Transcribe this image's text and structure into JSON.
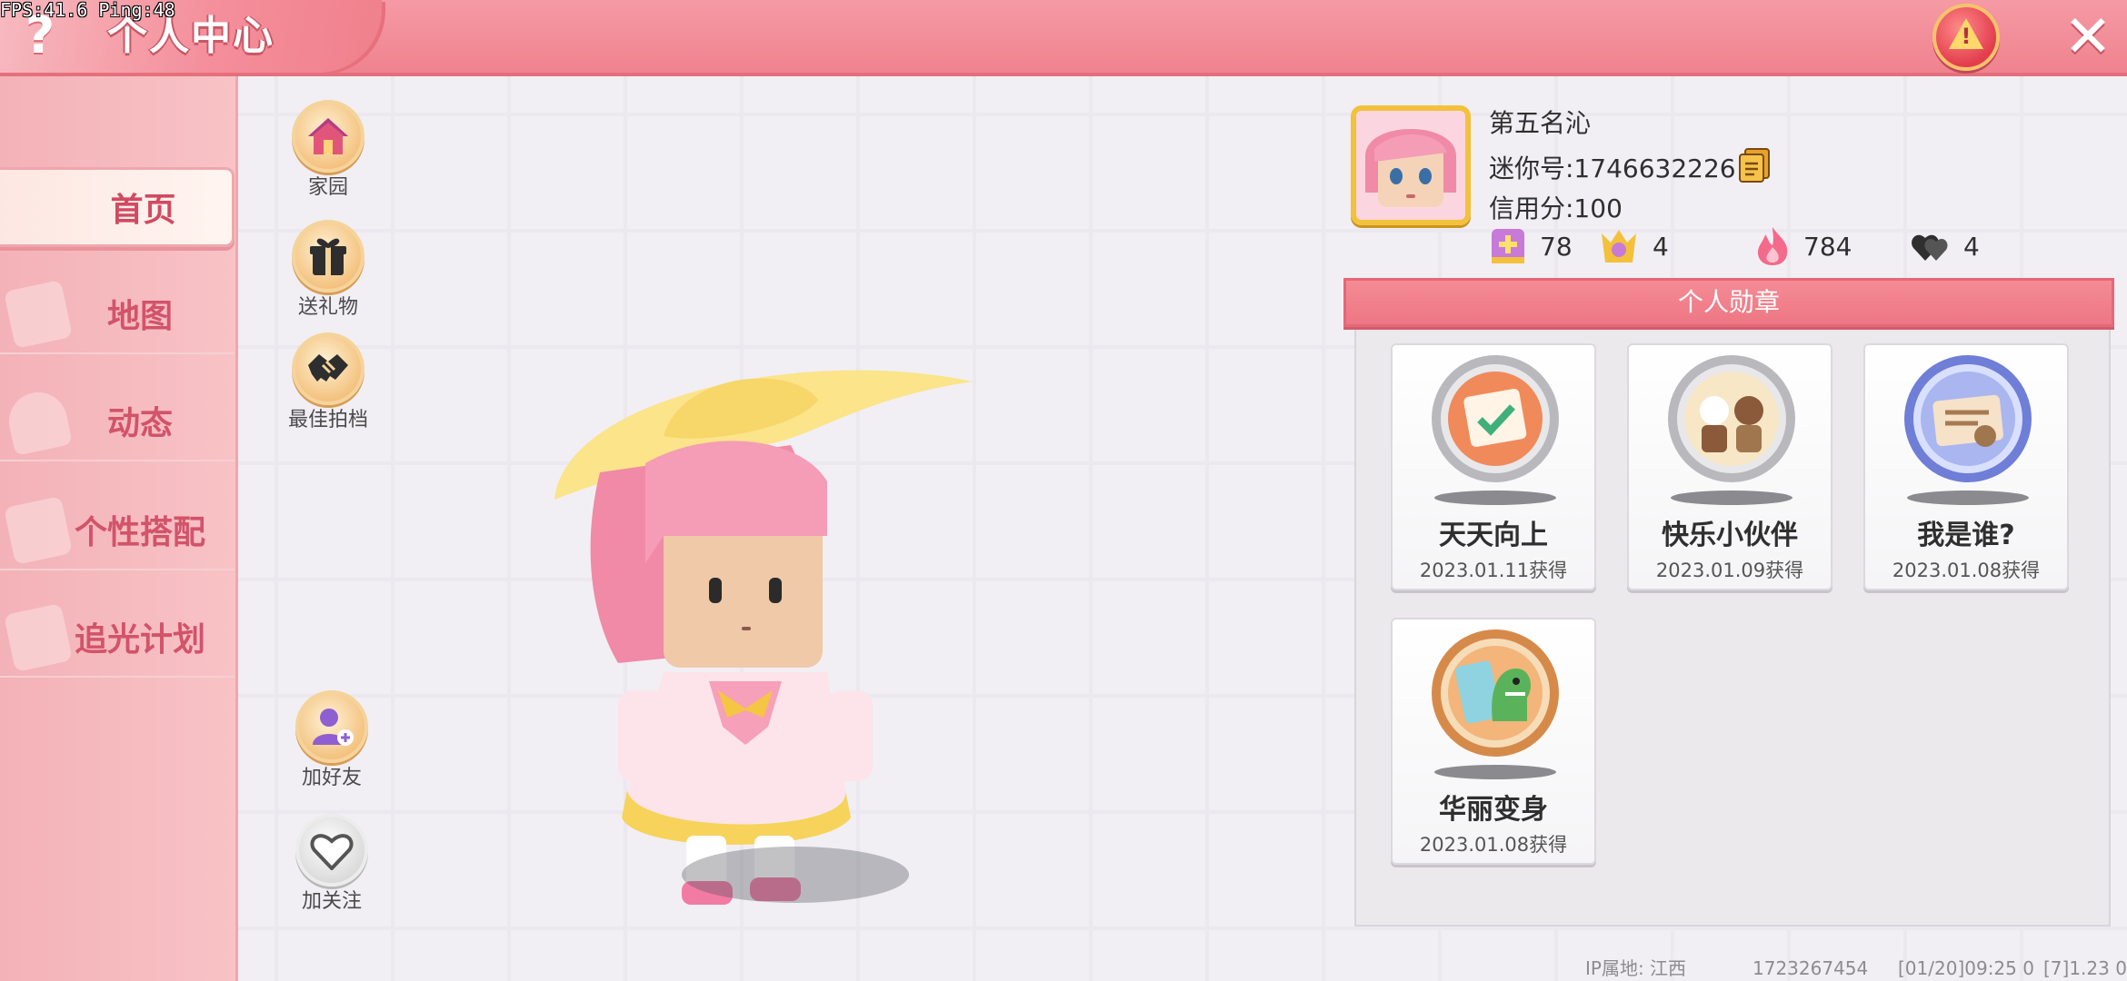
{
  "debug": {
    "fps": "FPS:41.6  Ping:48"
  },
  "header": {
    "title": "个人中心",
    "help_icon": "question-icon",
    "alert_icon": "warning-icon",
    "close_icon": "close-icon"
  },
  "sidebar": {
    "items": [
      {
        "label": "首页",
        "active": true
      },
      {
        "label": "地图",
        "active": false
      },
      {
        "label": "动态",
        "active": false
      },
      {
        "label": "个性搭配",
        "active": false
      },
      {
        "label": "追光计划",
        "active": false
      }
    ]
  },
  "actions": {
    "home": "家园",
    "gift": "送礼物",
    "best_pair": "最佳拍档",
    "add_friend": "加好友",
    "follow": "加关注"
  },
  "profile": {
    "name": "第五名沁",
    "mini_id": "迷你号:1746632226",
    "credit": "信用分:100",
    "stats": {
      "visits": "78",
      "fans": "4",
      "heat": "784",
      "likes": "4"
    }
  },
  "medals": {
    "title": "个人勋章",
    "items": [
      {
        "name": "天天向上",
        "date": "2023.01.11获得"
      },
      {
        "name": "快乐小伙伴",
        "date": "2023.01.09获得"
      },
      {
        "name": "我是谁?",
        "date": "2023.01.08获得"
      },
      {
        "name": "华丽变身",
        "date": "2023.01.08获得"
      }
    ]
  },
  "footer": {
    "ip": "IP属地: 江西",
    "uid": "1723267454",
    "time": "[01/20]09:25 0",
    "version": "[7]1.23 0"
  },
  "colors": {
    "header_pink": "#ef838f",
    "sidebar_pink": "#f3b2b7",
    "nav_text": "#d2536a",
    "medal_header": "#ee7784",
    "avatar_frame": "#f3c13b"
  }
}
